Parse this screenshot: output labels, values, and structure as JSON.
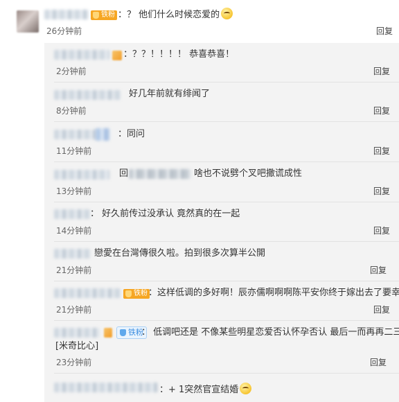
{
  "top_comment": {
    "badge_label": "铁粉",
    "text": "：？ 他们什么时候恋爱的",
    "time": "26分钟前",
    "reply_label": "回复"
  },
  "replies": [
    {
      "text": "：？？！！！！ 恭喜恭喜！",
      "time": "2分钟前",
      "reply_label": "回复"
    },
    {
      "text": "好几年前就有绯闻了",
      "time": "8分钟前",
      "reply_label": "回复"
    },
    {
      "text": "：同问",
      "time": "11分钟前",
      "reply_label": "回复"
    },
    {
      "prefix": "回",
      "text": "啥也不说劈个叉吧撒谎成性",
      "time": "13分钟前",
      "reply_label": "回复"
    },
    {
      "text": "： 好久前传过没承认 竟然真的在一起",
      "time": "14分钟前",
      "reply_label": "回复"
    },
    {
      "text": "戀愛在台灣傳很久啦。拍到很多次算半公開",
      "time": "21分钟前",
      "reply_label": "回复"
    },
    {
      "badge_label": "铁粉",
      "text": "：这样低调的多好啊！辰亦儒啊啊啊陈平安你终于嫁出去了要幸",
      "time": "21分钟前",
      "reply_label": "回复"
    },
    {
      "badge_label": "铁粉",
      "text": "： 低调吧还是 不像某些明星恋爱否认怀孕否认 最后一而再再二三打",
      "text_line2": "[米奇比心]",
      "time": "23分钟前",
      "reply_label": "回复"
    },
    {
      "text": "：+ 1突然官宣结婚"
    }
  ],
  "colors": {
    "reply_panel_bg": "#f3f3f3",
    "fan_badge_orange": "#f6a623",
    "fan_badge_blue": "#3d8ee0"
  }
}
